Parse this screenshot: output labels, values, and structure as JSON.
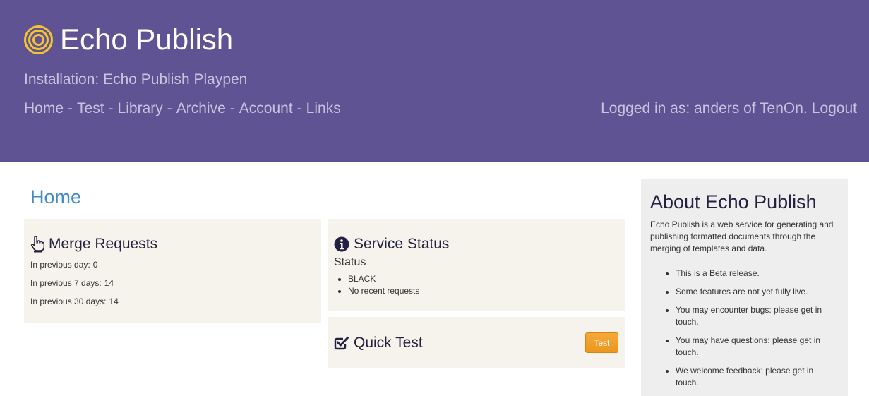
{
  "header": {
    "app_title": "Echo Publish",
    "installation": "Installation: Echo Publish Playpen",
    "nav": [
      "Home",
      "Test",
      "Library",
      "Archive",
      "Account",
      "Links"
    ],
    "nav_separator": "-",
    "login_text": "Logged in as: anders of TenOn.",
    "logout_label": "Logout",
    "background_color": "#5f5394",
    "logo_color": "#f4c430"
  },
  "main": {
    "page_title": "Home",
    "merge_requests": {
      "title": "Merge Requests",
      "icon": "pointing-hand-icon",
      "rows": [
        {
          "label": "In previous day:",
          "value": "0"
        },
        {
          "label": "In previous 7 days:",
          "value": "14"
        },
        {
          "label": "In previous 30 days:",
          "value": "14"
        }
      ]
    },
    "service_status": {
      "title": "Service Status",
      "icon": "info-icon",
      "sublabel": "Status",
      "items": [
        "BLACK",
        "No recent requests"
      ]
    },
    "quick_test": {
      "title": "Quick Test",
      "icon": "checkbox-icon",
      "button_label": "Test",
      "button_color": "#f0a030"
    }
  },
  "sidebar": {
    "title": "About Echo Publish",
    "description": "Echo Publish is a web service for generating and publishing formatted documents through the merging of templates and data.",
    "items": [
      "This is a Beta release.",
      "Some features are not yet fully live.",
      "You may encounter bugs: please get in touch.",
      "You may have questions: please get in touch.",
      "We welcome feedback: please get in touch."
    ]
  }
}
